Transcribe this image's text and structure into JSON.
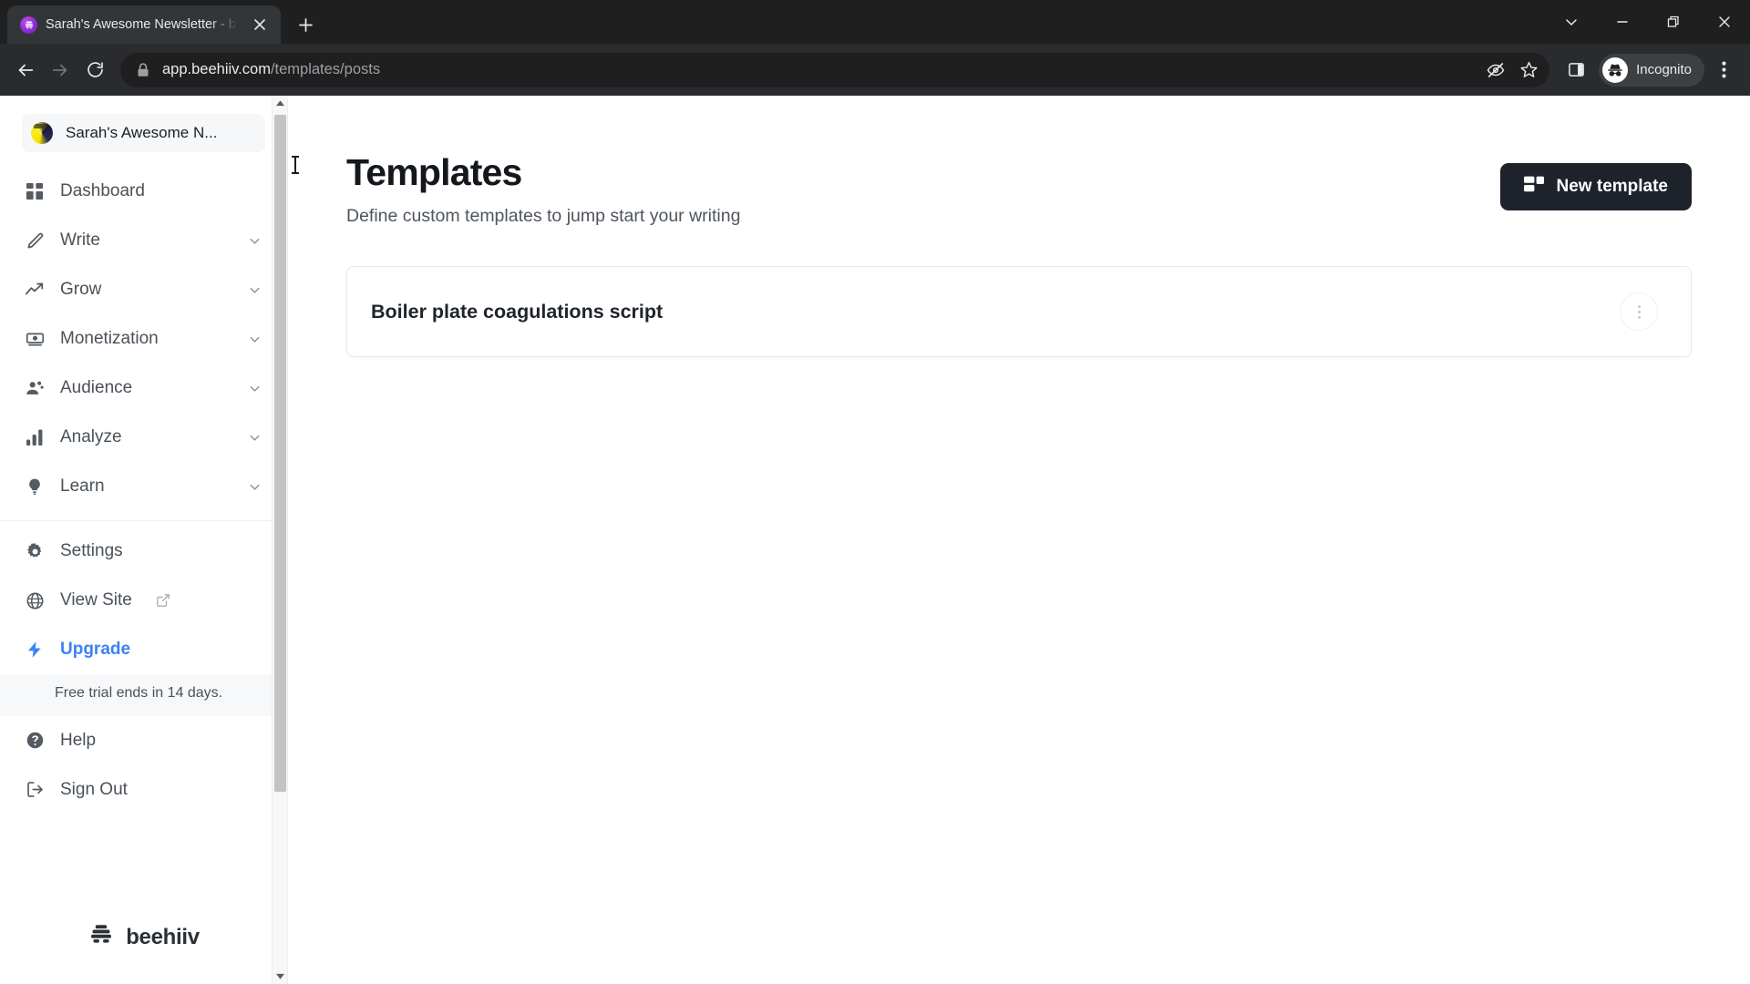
{
  "browser": {
    "tab": {
      "title": "Sarah's Awesome Newsletter - b",
      "favicon_name": "beehiiv-favicon",
      "close_label": "×"
    },
    "new_tab_label": "+",
    "window_controls": {
      "tab_search": "tab-search",
      "minimize": "minimize",
      "restore": "restore",
      "close": "close"
    },
    "nav": {
      "back": "Back",
      "forward": "Forward",
      "reload": "Reload"
    },
    "address": {
      "lock_icon": "lock-icon",
      "host": "app.beehiiv.com",
      "path": "/templates/posts"
    },
    "toolbar_icons": {
      "cookie_blocked": "third-party-cookie-blocked-icon",
      "bookmark": "bookmark-star-icon",
      "side_panel": "side-panel-icon",
      "menu": "chrome-menu-icon"
    },
    "incognito": {
      "label": "Incognito",
      "icon": "incognito-spy-icon"
    }
  },
  "sidebar": {
    "workspace": {
      "name": "Sarah's Awesome N...",
      "avatar": "newsletter-avatar"
    },
    "items": [
      {
        "label": "Dashboard",
        "icon": "dashboard-grid-icon",
        "chevron": false
      },
      {
        "label": "Write",
        "icon": "pencil-icon",
        "chevron": true
      },
      {
        "label": "Grow",
        "icon": "trend-up-icon",
        "chevron": true
      },
      {
        "label": "Monetization",
        "icon": "money-icon",
        "chevron": true
      },
      {
        "label": "Audience",
        "icon": "people-icon",
        "chevron": true
      },
      {
        "label": "Analyze",
        "icon": "bar-chart-icon",
        "chevron": true
      },
      {
        "label": "Learn",
        "icon": "lightbulb-icon",
        "chevron": true
      }
    ],
    "secondary": [
      {
        "label": "Settings",
        "icon": "gear-icon",
        "external": false
      },
      {
        "label": "View Site",
        "icon": "globe-icon",
        "external": true
      },
      {
        "label": "Upgrade",
        "icon": "lightning-bolt-icon",
        "external": false,
        "accent": true
      }
    ],
    "trial_notice": "Free trial ends in 14 days.",
    "footer": [
      {
        "label": "Help",
        "icon": "question-circle-icon"
      },
      {
        "label": "Sign Out",
        "icon": "sign-out-icon"
      }
    ],
    "logo": {
      "text": "beehiiv",
      "icon": "beehive-icon"
    },
    "scrollbar": {
      "up": "scroll-up",
      "down": "scroll-down"
    }
  },
  "main": {
    "title": "Templates",
    "subtitle": "Define custom templates to jump start your writing",
    "new_template_button": "New template",
    "new_template_icon": "template-layout-icon",
    "templates": [
      {
        "name": "Boiler plate coagulations script",
        "menu_icon": "kebab-menu-icon"
      }
    ]
  },
  "colors": {
    "accent_blue": "#3b82f6",
    "button_dark": "#1e222b",
    "chrome_dark": "#1f1f1f",
    "toolbar_dark": "#292b2f"
  }
}
